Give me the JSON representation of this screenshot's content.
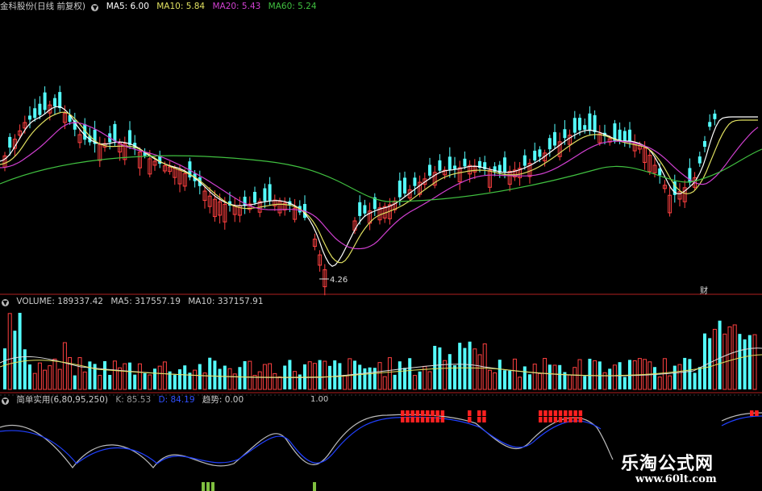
{
  "price_panel": {
    "stock_name": "金科股份(日线 前复权)",
    "ma5": "MA5: 6.00",
    "ma10": "MA10: 5.84",
    "ma20": "MA20: 5.43",
    "ma60": "MA60: 5.24",
    "low_marker": "4.26",
    "event_mark": "财",
    "colors": {
      "ma5": "#ffffff",
      "ma10": "#e0e060",
      "ma20": "#d040d0",
      "ma60": "#40c040"
    }
  },
  "volume_panel": {
    "volume": "VOLUME: 189337.42",
    "ma5": "MA5: 317557.19",
    "ma10": "MA10: 337157.91"
  },
  "indicator_panel": {
    "name": "简单实用(6,80,95,250)",
    "k": "K: 85.53",
    "d": "D: 84.19",
    "trend": "趋势: 0.00",
    "ref": "1.00"
  },
  "watermark": {
    "title": "乐淘公式网",
    "url": "www.60lt.com"
  },
  "colors": {
    "up": "#ff4040",
    "down": "#54ffff",
    "separator": "#b02020"
  }
}
